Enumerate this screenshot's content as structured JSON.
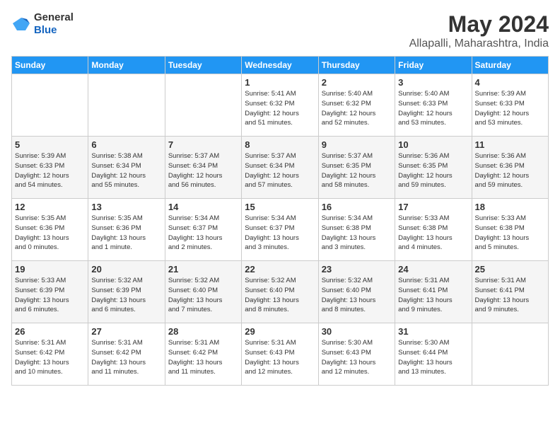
{
  "header": {
    "logo_general": "General",
    "logo_blue": "Blue",
    "month": "May 2024",
    "location": "Allapalli, Maharashtra, India"
  },
  "weekdays": [
    "Sunday",
    "Monday",
    "Tuesday",
    "Wednesday",
    "Thursday",
    "Friday",
    "Saturday"
  ],
  "weeks": [
    [
      {
        "day": "",
        "info": ""
      },
      {
        "day": "",
        "info": ""
      },
      {
        "day": "",
        "info": ""
      },
      {
        "day": "1",
        "info": "Sunrise: 5:41 AM\nSunset: 6:32 PM\nDaylight: 12 hours\nand 51 minutes."
      },
      {
        "day": "2",
        "info": "Sunrise: 5:40 AM\nSunset: 6:32 PM\nDaylight: 12 hours\nand 52 minutes."
      },
      {
        "day": "3",
        "info": "Sunrise: 5:40 AM\nSunset: 6:33 PM\nDaylight: 12 hours\nand 53 minutes."
      },
      {
        "day": "4",
        "info": "Sunrise: 5:39 AM\nSunset: 6:33 PM\nDaylight: 12 hours\nand 53 minutes."
      }
    ],
    [
      {
        "day": "5",
        "info": "Sunrise: 5:39 AM\nSunset: 6:33 PM\nDaylight: 12 hours\nand 54 minutes."
      },
      {
        "day": "6",
        "info": "Sunrise: 5:38 AM\nSunset: 6:34 PM\nDaylight: 12 hours\nand 55 minutes."
      },
      {
        "day": "7",
        "info": "Sunrise: 5:37 AM\nSunset: 6:34 PM\nDaylight: 12 hours\nand 56 minutes."
      },
      {
        "day": "8",
        "info": "Sunrise: 5:37 AM\nSunset: 6:34 PM\nDaylight: 12 hours\nand 57 minutes."
      },
      {
        "day": "9",
        "info": "Sunrise: 5:37 AM\nSunset: 6:35 PM\nDaylight: 12 hours\nand 58 minutes."
      },
      {
        "day": "10",
        "info": "Sunrise: 5:36 AM\nSunset: 6:35 PM\nDaylight: 12 hours\nand 59 minutes."
      },
      {
        "day": "11",
        "info": "Sunrise: 5:36 AM\nSunset: 6:36 PM\nDaylight: 12 hours\nand 59 minutes."
      }
    ],
    [
      {
        "day": "12",
        "info": "Sunrise: 5:35 AM\nSunset: 6:36 PM\nDaylight: 13 hours\nand 0 minutes."
      },
      {
        "day": "13",
        "info": "Sunrise: 5:35 AM\nSunset: 6:36 PM\nDaylight: 13 hours\nand 1 minute."
      },
      {
        "day": "14",
        "info": "Sunrise: 5:34 AM\nSunset: 6:37 PM\nDaylight: 13 hours\nand 2 minutes."
      },
      {
        "day": "15",
        "info": "Sunrise: 5:34 AM\nSunset: 6:37 PM\nDaylight: 13 hours\nand 3 minutes."
      },
      {
        "day": "16",
        "info": "Sunrise: 5:34 AM\nSunset: 6:38 PM\nDaylight: 13 hours\nand 3 minutes."
      },
      {
        "day": "17",
        "info": "Sunrise: 5:33 AM\nSunset: 6:38 PM\nDaylight: 13 hours\nand 4 minutes."
      },
      {
        "day": "18",
        "info": "Sunrise: 5:33 AM\nSunset: 6:38 PM\nDaylight: 13 hours\nand 5 minutes."
      }
    ],
    [
      {
        "day": "19",
        "info": "Sunrise: 5:33 AM\nSunset: 6:39 PM\nDaylight: 13 hours\nand 6 minutes."
      },
      {
        "day": "20",
        "info": "Sunrise: 5:32 AM\nSunset: 6:39 PM\nDaylight: 13 hours\nand 6 minutes."
      },
      {
        "day": "21",
        "info": "Sunrise: 5:32 AM\nSunset: 6:40 PM\nDaylight: 13 hours\nand 7 minutes."
      },
      {
        "day": "22",
        "info": "Sunrise: 5:32 AM\nSunset: 6:40 PM\nDaylight: 13 hours\nand 8 minutes."
      },
      {
        "day": "23",
        "info": "Sunrise: 5:32 AM\nSunset: 6:40 PM\nDaylight: 13 hours\nand 8 minutes."
      },
      {
        "day": "24",
        "info": "Sunrise: 5:31 AM\nSunset: 6:41 PM\nDaylight: 13 hours\nand 9 minutes."
      },
      {
        "day": "25",
        "info": "Sunrise: 5:31 AM\nSunset: 6:41 PM\nDaylight: 13 hours\nand 9 minutes."
      }
    ],
    [
      {
        "day": "26",
        "info": "Sunrise: 5:31 AM\nSunset: 6:42 PM\nDaylight: 13 hours\nand 10 minutes."
      },
      {
        "day": "27",
        "info": "Sunrise: 5:31 AM\nSunset: 6:42 PM\nDaylight: 13 hours\nand 11 minutes."
      },
      {
        "day": "28",
        "info": "Sunrise: 5:31 AM\nSunset: 6:42 PM\nDaylight: 13 hours\nand 11 minutes."
      },
      {
        "day": "29",
        "info": "Sunrise: 5:31 AM\nSunset: 6:43 PM\nDaylight: 13 hours\nand 12 minutes."
      },
      {
        "day": "30",
        "info": "Sunrise: 5:30 AM\nSunset: 6:43 PM\nDaylight: 13 hours\nand 12 minutes."
      },
      {
        "day": "31",
        "info": "Sunrise: 5:30 AM\nSunset: 6:44 PM\nDaylight: 13 hours\nand 13 minutes."
      },
      {
        "day": "",
        "info": ""
      }
    ]
  ]
}
